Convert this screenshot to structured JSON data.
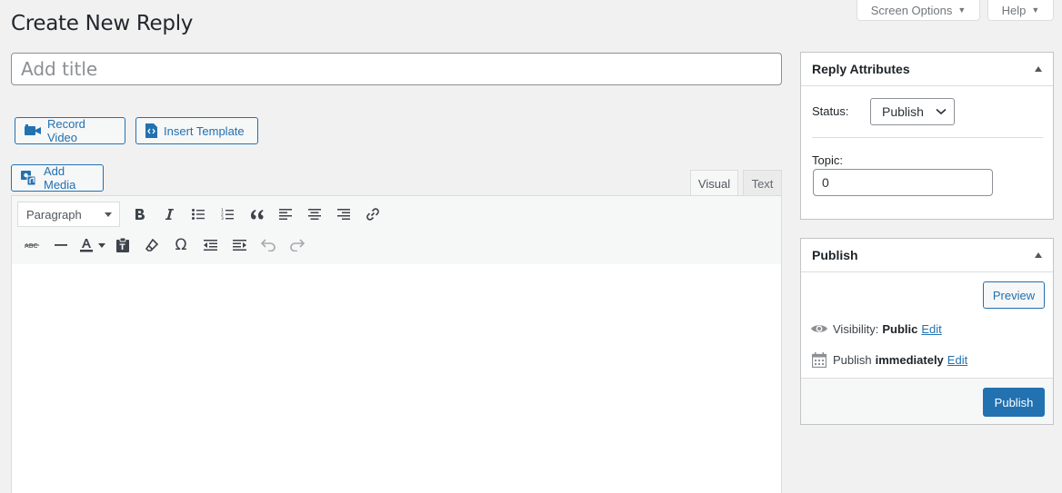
{
  "page": {
    "title": "Create New Reply"
  },
  "screen_meta": {
    "screen_options_label": "Screen Options",
    "help_label": "Help"
  },
  "post_title": {
    "placeholder": "Add title",
    "value": ""
  },
  "actions": {
    "record_video_label": "Record Video",
    "insert_template_label": "Insert Template",
    "add_media_label": "Add Media"
  },
  "editor": {
    "tabs": {
      "visual": "Visual",
      "text": "Text"
    },
    "format_select": "Paragraph",
    "toolbar_row1_icons": [
      "bold-icon",
      "italic-icon",
      "bulleted-list-icon",
      "numbered-list-icon",
      "blockquote-icon",
      "align-left-icon",
      "align-center-icon",
      "align-right-icon",
      "link-icon"
    ],
    "toolbar_row2_icons": [
      "strikethrough-icon",
      "horizontal-line-icon",
      "text-color-icon",
      "paste-as-text-icon",
      "clear-formatting-icon",
      "special-character-icon",
      "outdent-icon",
      "indent-icon",
      "undo-icon",
      "redo-icon"
    ]
  },
  "reply_attributes": {
    "title": "Reply Attributes",
    "status_label": "Status:",
    "status_value": "Publish",
    "topic_label": "Topic:",
    "topic_value": "0"
  },
  "publish": {
    "title": "Publish",
    "preview_label": "Preview",
    "visibility_label": "Visibility:",
    "visibility_value": "Public",
    "edit_label": "Edit",
    "publish_label": "Publish",
    "publish_when": "immediately",
    "publish_button": "Publish"
  },
  "colors": {
    "primary": "#2271b1",
    "background": "#f1f1f1",
    "border": "#c3c4c7"
  }
}
